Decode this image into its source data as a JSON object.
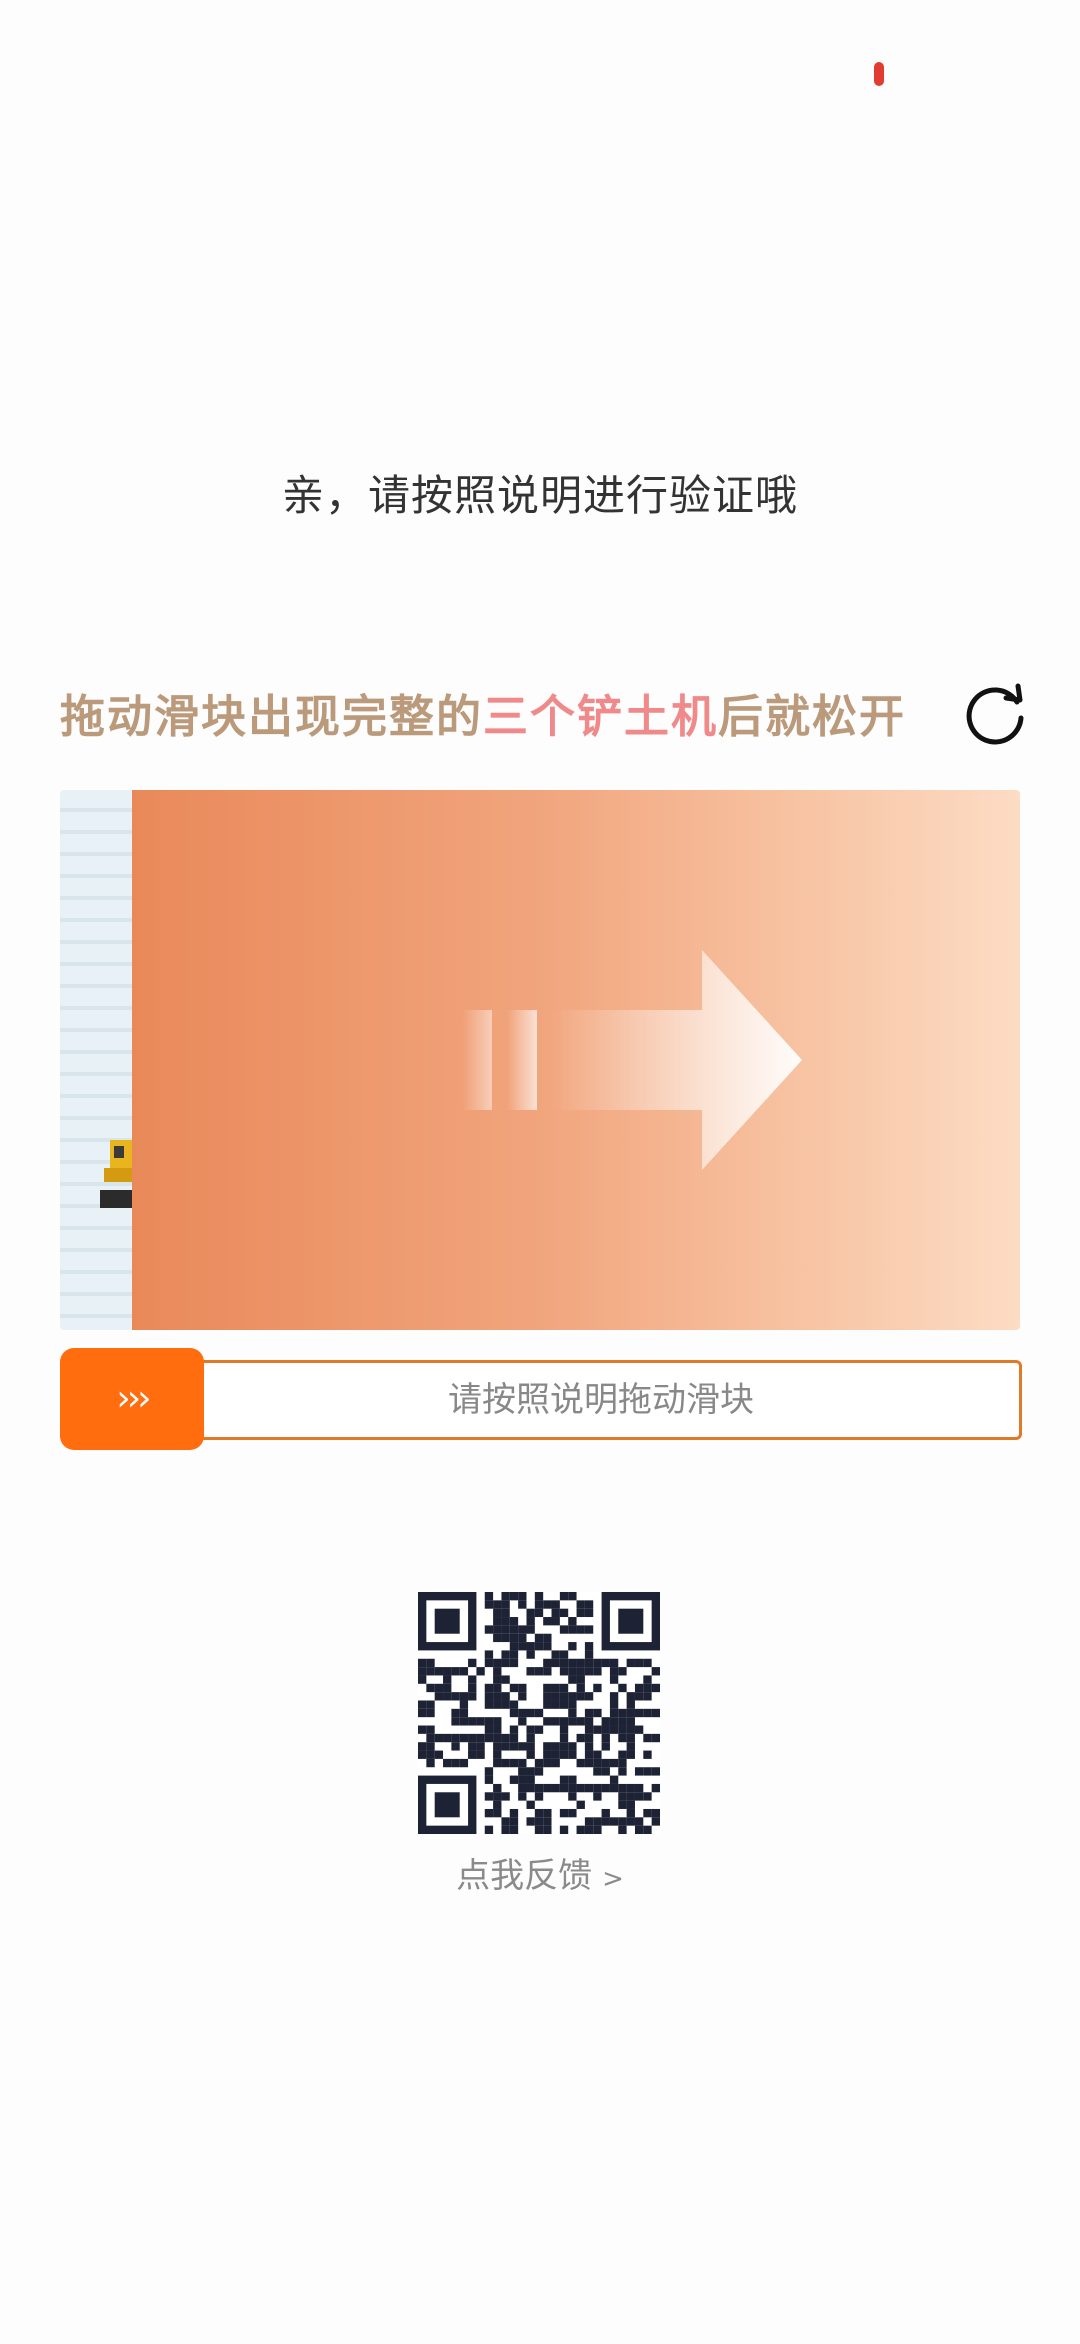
{
  "status": {
    "indicator_color": "#e03c31"
  },
  "prompt": {
    "text": "亲，请按照说明进行验证哦"
  },
  "instruction": {
    "part1": "拖动滑块出现完整的",
    "highlight": "三个铲土机",
    "part2": "后就松开",
    "refresh_icon": "refresh-icon"
  },
  "slider": {
    "handle_label": "›››",
    "track_label": "请按照说明拖动滑块",
    "accent_color": "#ff6d0f"
  },
  "qr": {
    "icon": "qr-code"
  },
  "feedback": {
    "label": "点我反馈",
    "chevron": ">"
  }
}
